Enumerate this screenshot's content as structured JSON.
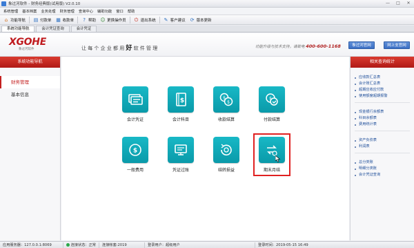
{
  "window": {
    "title": "象过河软件 - 财务经典版(试用版) V2.0.10",
    "controls": [
      "—",
      "□",
      "✕"
    ]
  },
  "menubar": {
    "items": [
      "系统管理",
      "基本档案",
      "业务处理",
      "财务管理",
      "查询中心",
      "辅助功能",
      "窗口",
      "帮助"
    ]
  },
  "toolbar": {
    "buttons": [
      {
        "label": "功能导航",
        "icon": "home-icon"
      },
      {
        "label": "付款单",
        "icon": "payment-icon"
      },
      {
        "label": "收款单",
        "icon": "receipt-icon"
      },
      {
        "label": "帮助",
        "icon": "help-icon"
      },
      {
        "label": "更换操作员",
        "icon": "switch-user-icon"
      },
      {
        "label": "退出系统",
        "icon": "exit-icon"
      },
      {
        "label": "客户建议",
        "icon": "suggestion-icon"
      },
      {
        "label": "版本更新",
        "icon": "update-icon"
      }
    ]
  },
  "tabs": [
    "系统功能导航",
    "会计凭证查询",
    "会计凭证"
  ],
  "banner": {
    "brand": "XGOHE",
    "brand_sub": "象过河软件",
    "slogan_pre": "让每个企业都用",
    "slogan_bold": "好",
    "slogan_post": "软件管理",
    "service_text": "功能升级与技术支持，请致电",
    "service_phone": "400-600-1168",
    "official_site_button": "象过河官网",
    "online_site_button": "网上支官网"
  },
  "left_panel": {
    "header": "系统功能导航",
    "items": [
      {
        "label": "财务管理",
        "active": true
      },
      {
        "label": "基本信息",
        "active": false
      }
    ]
  },
  "main": {
    "functions": [
      {
        "label": "会计凭证",
        "icon": "voucher-icon"
      },
      {
        "label": "会计科目",
        "icon": "ledger-book-icon"
      },
      {
        "label": "收款结算",
        "icon": "collection-settlement-icon"
      },
      {
        "label": "付款结算",
        "icon": "payment-settlement-icon"
      },
      {
        "label": "一般费用",
        "icon": "expense-icon"
      },
      {
        "label": "凭证过账",
        "icon": "voucher-posting-icon"
      },
      {
        "label": "结转损益",
        "icon": "carry-forward-icon"
      },
      {
        "label": "期末月结",
        "icon": "month-end-close-icon",
        "highlighted": true
      }
    ]
  },
  "right_panel": {
    "header": "相关查询统计",
    "groups": [
      [
        "应收款汇总表",
        "会计账汇总表",
        "超期应收应付款",
        "使用额度超期报警"
      ],
      [
        "现金银行余额表",
        "科目余额表",
        "费用统计表"
      ],
      [
        "资产负债表",
        "利润表"
      ],
      [
        "总分类账",
        "明细分类账",
        "会计凭证查询"
      ]
    ]
  },
  "statusbar": {
    "server": "应用服务器：127.0.0.1:8069",
    "connection": "连接状态：正常",
    "account_set": "连接帐套:2019",
    "login_user": "登录用户：超级用户",
    "login_time": "登录时间：2019-05-15 16:49"
  },
  "colors": {
    "accent_red": "#c31f1f",
    "tile_teal": "#12a9b8",
    "link_blue": "#1f4f9a"
  }
}
